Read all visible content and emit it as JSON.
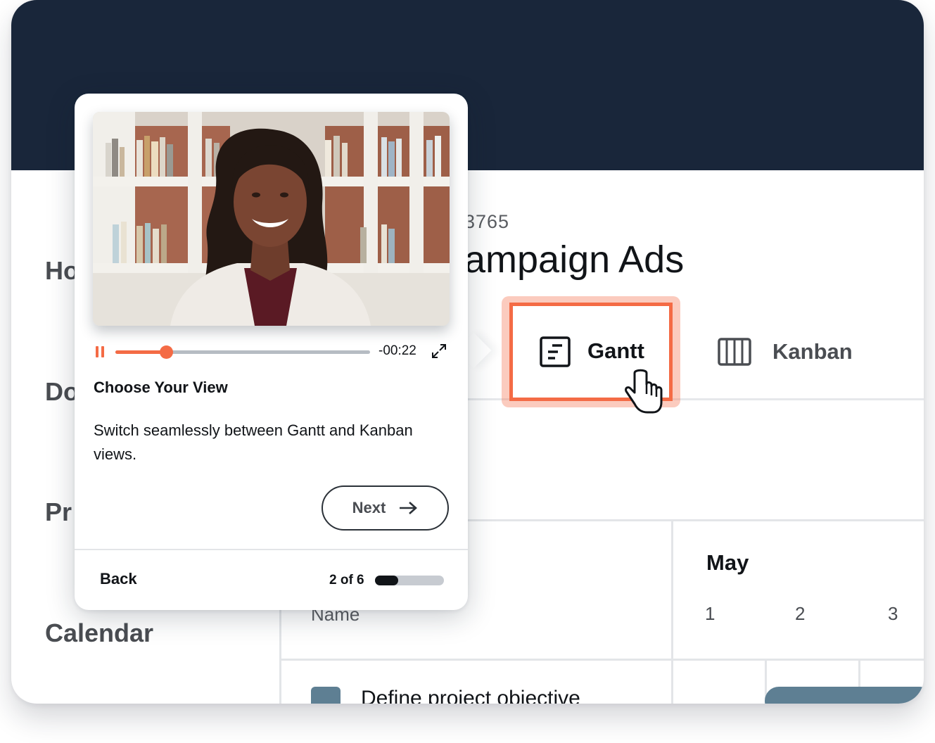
{
  "sidebar": {
    "items": [
      {
        "label": "Ho"
      },
      {
        "label": "Do"
      },
      {
        "label": "Pr"
      },
      {
        "label": "Calendar"
      }
    ]
  },
  "project": {
    "id": "3765",
    "title": "ampaign Ads"
  },
  "view_tabs": {
    "gantt_label": "Gantt",
    "kanban_label": "Kanban",
    "active": "Gantt",
    "gantt_icon": "gantt-chart-icon",
    "kanban_icon": "kanban-board-icon"
  },
  "table": {
    "name_header": "Name",
    "month": "May",
    "days": [
      "1",
      "2",
      "3"
    ],
    "rows": [
      {
        "name": "Define project objective"
      }
    ]
  },
  "tour": {
    "video": {
      "time_remaining": "-00:22",
      "progress": 0.2,
      "state": "playing",
      "pause_icon": "pause-icon",
      "fullscreen_icon": "fullscreen-icon"
    },
    "heading": "Choose Your View",
    "body": "Switch seamlessly between Gantt and Kanban views.",
    "next_label": "Next",
    "back_label": "Back",
    "step_text": "2 of 6",
    "step_current": 2,
    "step_total": 6
  },
  "colors": {
    "banner": "#19263a",
    "accent": "#f46b45",
    "task": "#5e7f93",
    "text": "#111418"
  }
}
